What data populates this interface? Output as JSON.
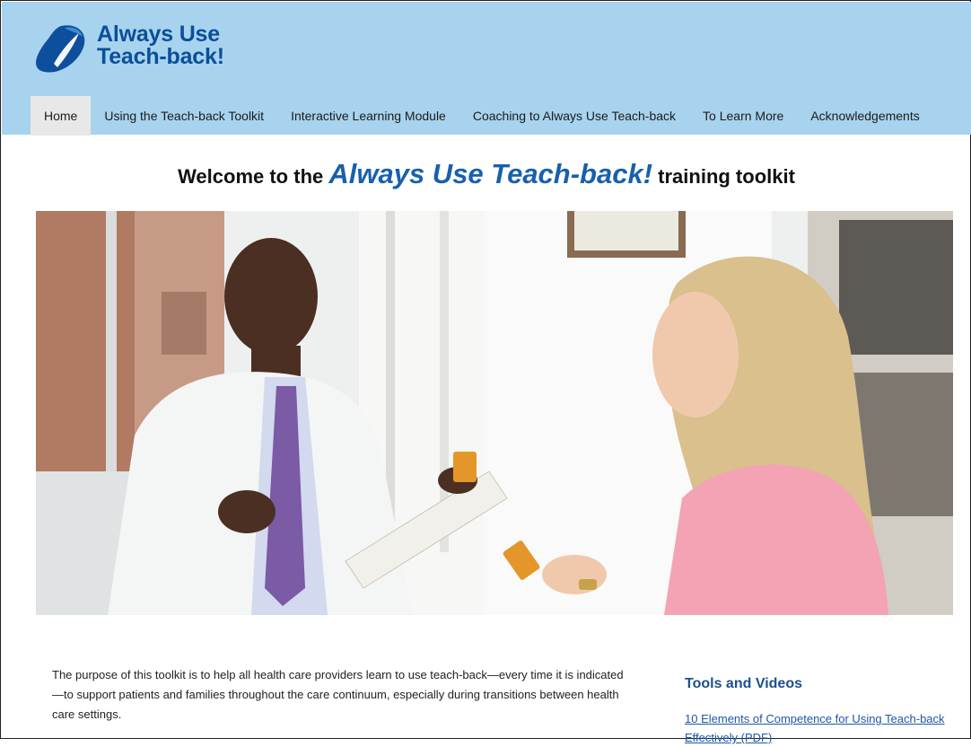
{
  "logo": {
    "line1": "Always Use",
    "line2": "Teach-back!",
    "icon": "always-use-teach-back-logo-icon",
    "color": "#0a4f99"
  },
  "nav": {
    "items": [
      "Home",
      "Using the Teach-back Toolkit",
      "Interactive Learning Module",
      "Coaching to Always Use Teach-back",
      "To Learn More",
      "Acknowledgements"
    ],
    "active": "Home"
  },
  "welcome": {
    "prefix": "Welcome to the ",
    "brand": "Always Use Teach-back!",
    "suffix": " training toolkit"
  },
  "intro_text": "The purpose of this toolkit is to help all health care providers learn to use teach-back—every time it is indicated—to support patients and families throughout the care continuum, especially during transitions between health care settings.",
  "sidebar": {
    "title": "Tools and Videos",
    "links": [
      "10 Elements of Competence for Using Teach-back Effectively (PDF)"
    ]
  },
  "colors": {
    "header_bg": "#a7d3ee",
    "brand_blue": "#1860ad",
    "link_blue": "#1e57a8"
  }
}
